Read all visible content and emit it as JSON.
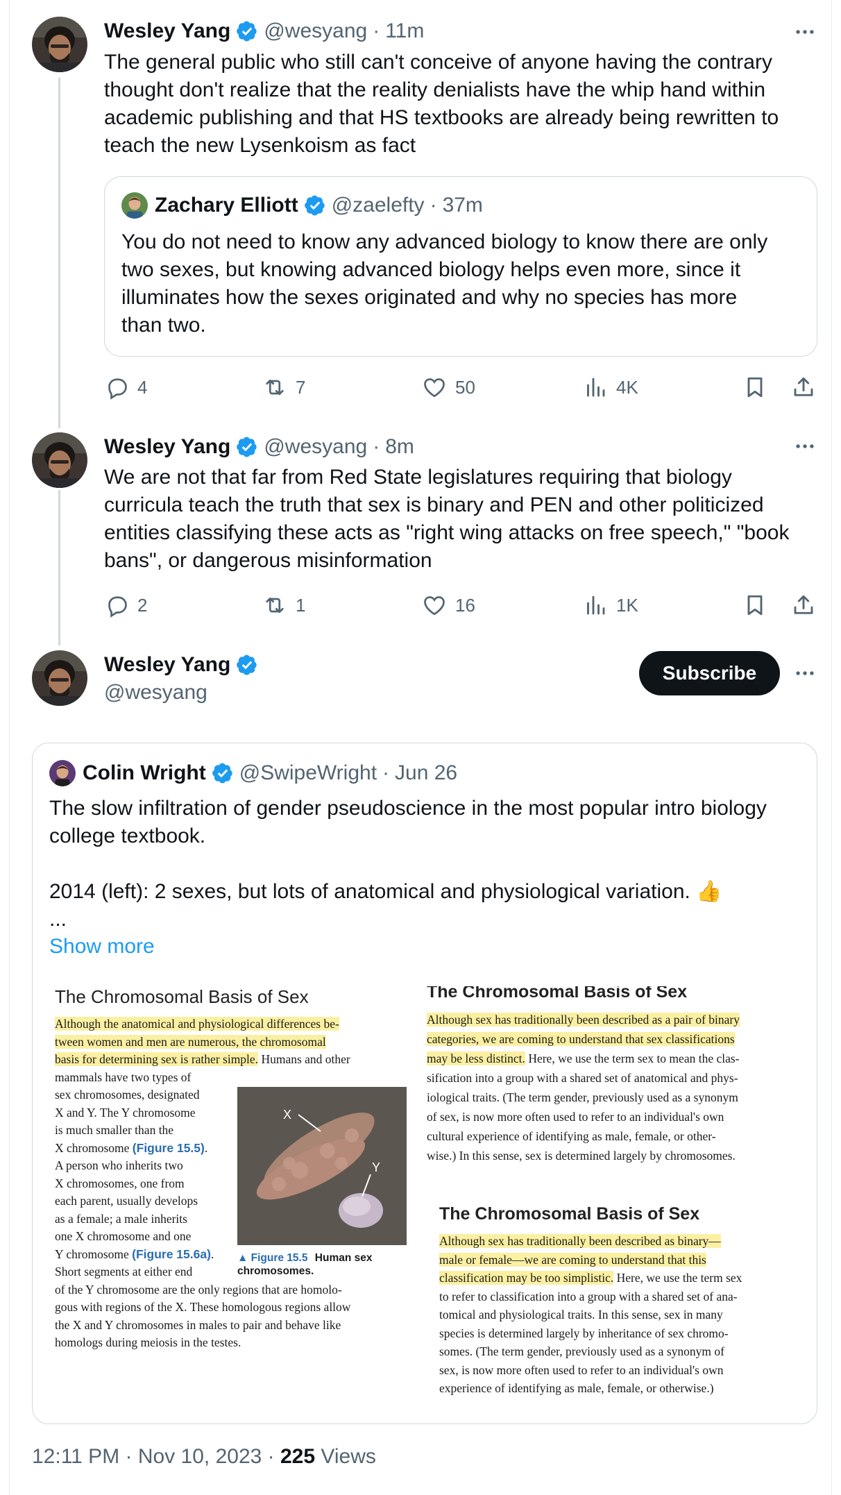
{
  "tweet1": {
    "name": "Wesley Yang",
    "handle": "@wesyang",
    "time": "11m",
    "lines": [
      "The general public who still can't conceive of anyone having the contrary",
      "thought don't realize that the reality denialists have the whip hand within",
      "academic publishing and that HS textbooks are already being rewritten to",
      "teach the new Lysenkoism as fact"
    ],
    "quote": {
      "name": "Zachary Elliott",
      "handle": "@zaelefty",
      "time": "37m",
      "lines": [
        "You do not need to know any advanced biology to know there are only",
        "two sexes, but knowing advanced biology helps even more, since it",
        "illuminates how the sexes originated and why no species has more",
        "than two."
      ]
    },
    "replies": "4",
    "reposts": "7",
    "likes": "50",
    "views": "4K"
  },
  "tweet2": {
    "name": "Wesley Yang",
    "handle": "@wesyang",
    "time": "8m",
    "lines": [
      "We are not that far from Red State legislatures requiring that biology",
      "curricula teach the truth that sex is binary and PEN and other politicized",
      "entities classifying these acts as \"right wing attacks on free speech,\" \"book",
      "bans\", or dangerous misinformation"
    ],
    "replies": "2",
    "reposts": "1",
    "likes": "16",
    "views": "1K"
  },
  "main": {
    "name": "Wesley Yang",
    "handle": "@wesyang",
    "subscribe_label": "Subscribe",
    "quote": {
      "name": "Colin Wright",
      "handle": "@SwipeWright",
      "time": "Jun 26",
      "lines": [
        "The slow infiltration of gender pseudoscience in the most popular intro biology",
        "college textbook.",
        "",
        "2014 (left): 2 sexes, but lots of anatomical and physiological variation. 👍",
        "..."
      ],
      "show_more": "Show more"
    },
    "footer": {
      "time": "12:11 PM",
      "date": "Nov 10, 2023",
      "views_count": "225",
      "views_label": "Views"
    }
  },
  "textbook": {
    "left": {
      "title": "The Chromosomal Basis of Sex",
      "hl_lines": [
        "Although the anatomical and physiological differences be-",
        "tween women and men are numerous, the chromosomal",
        "basis for determining sex is rather simple."
      ],
      "hl_tail": " Humans and other",
      "col_lines": [
        "mammals have two types of",
        "sex chromosomes, designated",
        "X and Y. The Y chromosome",
        "is much smaller than the",
        "X chromosome ",
        "A person who inherits two",
        "X chromosomes, one from",
        "each parent, usually develops",
        "as a female; a male inherits",
        "one X chromosome and one",
        "Y chromosome ",
        "Short segments at either end"
      ],
      "fig_ref_a": "(Figure 15.5)",
      "fig_ref_b": "(Figure 15.6a)",
      "bottom_lines": [
        "of the Y chromosome are the only regions that are homolo-",
        "gous with regions of the X. These homologous regions allow",
        "the X and Y chromosomes in males to pair and behave like",
        "homologs during meiosis in the testes."
      ],
      "caption_fig": "▲ Figure 15.5",
      "caption_text": "Human sex",
      "caption_text2": "chromosomes.",
      "label_x": "X",
      "label_y": "Y"
    },
    "right_top": {
      "title": "The Chromosomal Basis of Sex",
      "hl_lines": [
        "Although sex has traditionally been described as a pair of binary",
        "categories, we are coming to understand that sex classifications",
        "may be less distinct."
      ],
      "hl_tail": " Here, we use the term sex to mean the clas-",
      "lines": [
        "sification into a group with a shared set of anatomical and phys-",
        "iological traits. (The term gender, previously used as a synonym",
        "of sex, is now more often used to refer to an individual's own",
        "cultural experience of identifying as male, female, or other-",
        "wise.) In this sense, sex is determined largely by chromosomes."
      ]
    },
    "right_bottom": {
      "title": "The Chromosomal Basis of Sex",
      "hl_lines": [
        "Although sex has traditionally been described as binary—",
        "male or female—we are coming to understand that this",
        "classification may be too simplistic."
      ],
      "hl_tail": " Here, we use the term sex",
      "lines": [
        "to refer to classification into a group with a shared set of ana-",
        "tomical and physiological traits. In this sense, sex in many",
        "species is determined largely by inheritance of sex chromo-",
        "somes. (The term gender, previously used as a synonym of",
        "sex, is now more often used to refer to an individual's own",
        "experience of identifying as male, female, or otherwise.)"
      ]
    }
  },
  "icons": {
    "verified": "verified-badge-icon",
    "more": "more-dots-icon",
    "reply": "reply-icon",
    "repost": "repost-icon",
    "like": "like-icon",
    "views": "views-icon",
    "bookmark": "bookmark-icon",
    "share": "share-icon"
  },
  "colors": {
    "verified": "#1d9bf0",
    "link": "#1d9bf0",
    "secondary_text": "#536471",
    "highlight": "#fbf0a2",
    "button": "#0f1419"
  }
}
